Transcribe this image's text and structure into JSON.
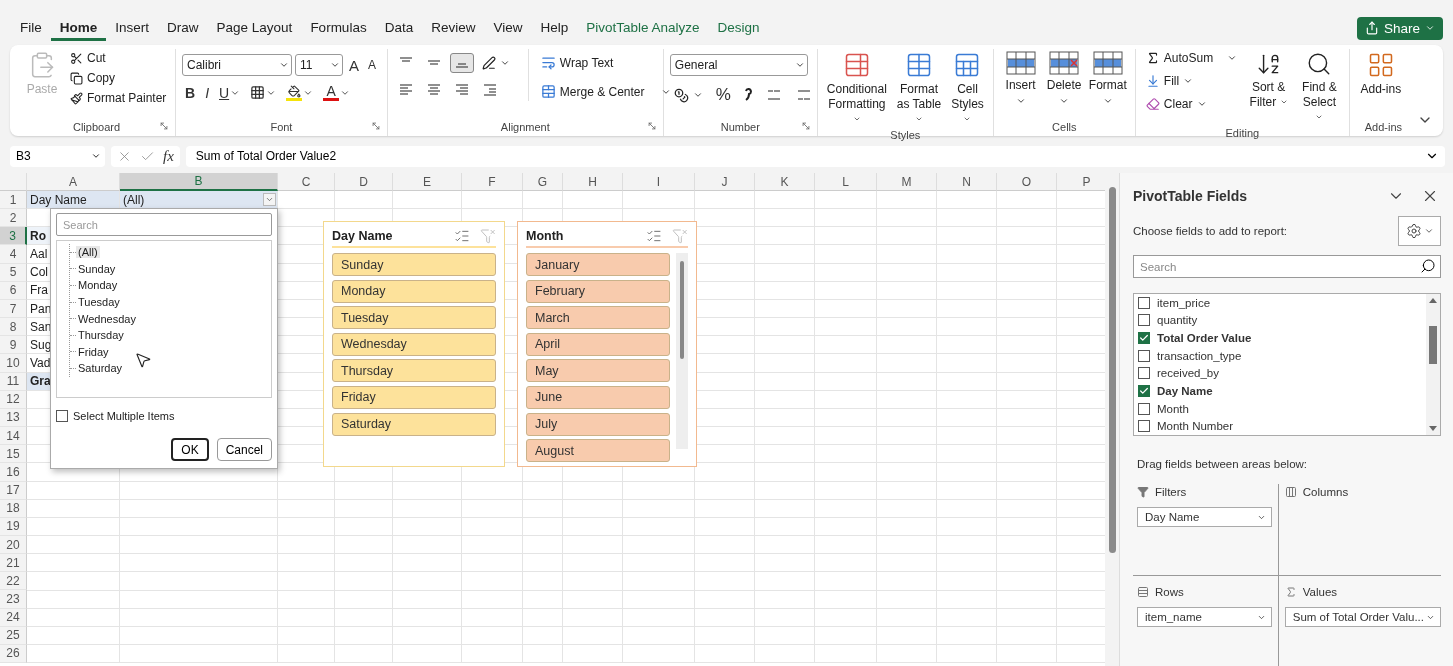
{
  "menu_tabs": [
    {
      "label": "File",
      "selected": false,
      "kind": "normal"
    },
    {
      "label": "Home",
      "selected": true,
      "kind": "normal"
    },
    {
      "label": "Insert",
      "selected": false,
      "kind": "normal"
    },
    {
      "label": "Draw",
      "selected": false,
      "kind": "normal"
    },
    {
      "label": "Page Layout",
      "selected": false,
      "kind": "normal"
    },
    {
      "label": "Formulas",
      "selected": false,
      "kind": "normal"
    },
    {
      "label": "Data",
      "selected": false,
      "kind": "normal"
    },
    {
      "label": "Review",
      "selected": false,
      "kind": "normal"
    },
    {
      "label": "View",
      "selected": false,
      "kind": "normal"
    },
    {
      "label": "Help",
      "selected": false,
      "kind": "normal"
    },
    {
      "label": "PivotTable Analyze",
      "selected": false,
      "kind": "contextual"
    },
    {
      "label": "Design",
      "selected": false,
      "kind": "contextual"
    }
  ],
  "share_button": "Share",
  "clipboard": {
    "paste": "Paste",
    "paste_disabled": true,
    "cut": "Cut",
    "copy": "Copy",
    "format_painter": "Format Painter",
    "label": "Clipboard"
  },
  "font": {
    "name": "Calibri",
    "size": "11",
    "grow": "A",
    "shrink": "A",
    "bold": "B",
    "italic": "I",
    "underline": "U",
    "color_glyph": "A",
    "label": "Font"
  },
  "alignment": {
    "vertical_align": [
      {
        "selected": false
      },
      {
        "selected": false
      },
      {
        "selected": true
      }
    ],
    "wrap_text": "Wrap Text",
    "merge_center": "Merge & Center",
    "label": "Alignment"
  },
  "number": {
    "format": "General",
    "percent": "%",
    "label": "Number"
  },
  "styles": {
    "buttons": [
      "Conditional Formatting",
      "Format as Table",
      "Cell Styles"
    ],
    "label": "Styles"
  },
  "cells": {
    "buttons": [
      "Insert",
      "Delete",
      "Format"
    ],
    "label": "Cells"
  },
  "editing": {
    "autosum": "AutoSum",
    "fill": "Fill",
    "clear": "Clear",
    "sort_filter": "Sort & Filter",
    "find_select": "Find & Select",
    "label": "Editing"
  },
  "addins": {
    "button": "Add-ins",
    "label": "Add-ins"
  },
  "formula_bar": {
    "name_box": "B3",
    "fx": "fx",
    "formula": "Sum of Total Order Value2"
  },
  "sheet": {
    "columns": [
      {
        "label": "A",
        "selected": false
      },
      {
        "label": "B",
        "selected": true
      },
      {
        "label": "C",
        "selected": false
      },
      {
        "label": "D",
        "selected": false
      },
      {
        "label": "E",
        "selected": false
      },
      {
        "label": "F",
        "selected": false
      },
      {
        "label": "G",
        "selected": false
      },
      {
        "label": "H",
        "selected": false
      },
      {
        "label": "I",
        "selected": false
      },
      {
        "label": "J",
        "selected": false
      },
      {
        "label": "K",
        "selected": false
      },
      {
        "label": "L",
        "selected": false
      },
      {
        "label": "M",
        "selected": false
      },
      {
        "label": "N",
        "selected": false
      },
      {
        "label": "O",
        "selected": false
      },
      {
        "label": "P",
        "selected": false
      }
    ],
    "rows": [
      {
        "number": "1",
        "selected": false,
        "kind": "filter",
        "a": "Day Name",
        "b": "(All)"
      },
      {
        "number": "2",
        "selected": false,
        "kind": "empty"
      },
      {
        "number": "3",
        "selected": true,
        "kind": "header",
        "a": "Ro"
      },
      {
        "number": "4",
        "selected": false,
        "kind": "item",
        "a": "Aal"
      },
      {
        "number": "5",
        "selected": false,
        "kind": "item",
        "a": "Col"
      },
      {
        "number": "6",
        "selected": false,
        "kind": "item",
        "a": "Fra"
      },
      {
        "number": "7",
        "selected": false,
        "kind": "item",
        "a": "Pan"
      },
      {
        "number": "8",
        "selected": false,
        "kind": "item",
        "a": "San"
      },
      {
        "number": "9",
        "selected": false,
        "kind": "item",
        "a": "Sug"
      },
      {
        "number": "10",
        "selected": false,
        "kind": "item",
        "a": "Vad"
      },
      {
        "number": "11",
        "selected": false,
        "kind": "total",
        "a": "Gra"
      },
      {
        "number": "12",
        "selected": false,
        "kind": "empty"
      },
      {
        "number": "13",
        "selected": false,
        "kind": "empty"
      },
      {
        "number": "14",
        "selected": false,
        "kind": "empty"
      },
      {
        "number": "15",
        "selected": false,
        "kind": "empty"
      },
      {
        "number": "16",
        "selected": false,
        "kind": "empty"
      },
      {
        "number": "17",
        "selected": false,
        "kind": "empty"
      },
      {
        "number": "18",
        "selected": false,
        "kind": "empty"
      },
      {
        "number": "19",
        "selected": false,
        "kind": "empty"
      },
      {
        "number": "20",
        "selected": false,
        "kind": "empty"
      },
      {
        "number": "21",
        "selected": false,
        "kind": "empty"
      },
      {
        "number": "22",
        "selected": false,
        "kind": "empty"
      },
      {
        "number": "23",
        "selected": false,
        "kind": "empty"
      },
      {
        "number": "24",
        "selected": false,
        "kind": "empty"
      },
      {
        "number": "25",
        "selected": false,
        "kind": "empty"
      },
      {
        "number": "26",
        "selected": false,
        "kind": "empty"
      }
    ]
  },
  "filter_dropdown": {
    "search_placeholder": "Search",
    "items": [
      {
        "label": "(All)",
        "selected": true
      },
      {
        "label": "Sunday",
        "selected": false
      },
      {
        "label": "Monday",
        "selected": false
      },
      {
        "label": "Tuesday",
        "selected": false
      },
      {
        "label": "Wednesday",
        "selected": false
      },
      {
        "label": "Thursday",
        "selected": false
      },
      {
        "label": "Friday",
        "selected": false
      },
      {
        "label": "Saturday",
        "selected": false
      }
    ],
    "select_multiple": {
      "label": "Select Multiple Items",
      "checked": false
    },
    "ok": "OK",
    "cancel": "Cancel"
  },
  "slicers": [
    {
      "title": "Day Name",
      "color": "#fde29b",
      "scrollable": false,
      "items": [
        {
          "label": "Sunday",
          "selected": true
        },
        {
          "label": "Monday",
          "selected": true
        },
        {
          "label": "Tuesday",
          "selected": true
        },
        {
          "label": "Wednesday",
          "selected": true
        },
        {
          "label": "Thursday",
          "selected": true
        },
        {
          "label": "Friday",
          "selected": true
        },
        {
          "label": "Saturday",
          "selected": true
        }
      ]
    },
    {
      "title": "Month",
      "color": "#f8cbad",
      "scrollable": true,
      "items": [
        {
          "label": "January",
          "selected": true
        },
        {
          "label": "February",
          "selected": true
        },
        {
          "label": "March",
          "selected": true
        },
        {
          "label": "April",
          "selected": true
        },
        {
          "label": "May",
          "selected": true
        },
        {
          "label": "June",
          "selected": true
        },
        {
          "label": "July",
          "selected": true
        },
        {
          "label": "August",
          "selected": true
        }
      ]
    }
  ],
  "pivot_panel": {
    "title": "PivotTable Fields",
    "subtitle": "Choose fields to add to report:",
    "search_placeholder": "Search",
    "fields": [
      {
        "label": "item_price",
        "checked": false
      },
      {
        "label": "quantity",
        "checked": false
      },
      {
        "label": "Total Order Value",
        "checked": true
      },
      {
        "label": "transaction_type",
        "checked": false
      },
      {
        "label": "received_by",
        "checked": false
      },
      {
        "label": "Day Name",
        "checked": true
      },
      {
        "label": "Month",
        "checked": false
      },
      {
        "label": "Month Number",
        "checked": false
      }
    ],
    "drag_hint": "Drag fields between areas below:",
    "areas": [
      {
        "kind": "filters",
        "label": "Filters",
        "items": [
          "Day Name"
        ]
      },
      {
        "kind": "columns",
        "label": "Columns"
      },
      {
        "kind": "rows",
        "label": "Rows",
        "items": [
          "item_name"
        ]
      },
      {
        "kind": "values",
        "label": "Values",
        "items": [
          "Sum of Total Order Valu..."
        ]
      }
    ]
  }
}
